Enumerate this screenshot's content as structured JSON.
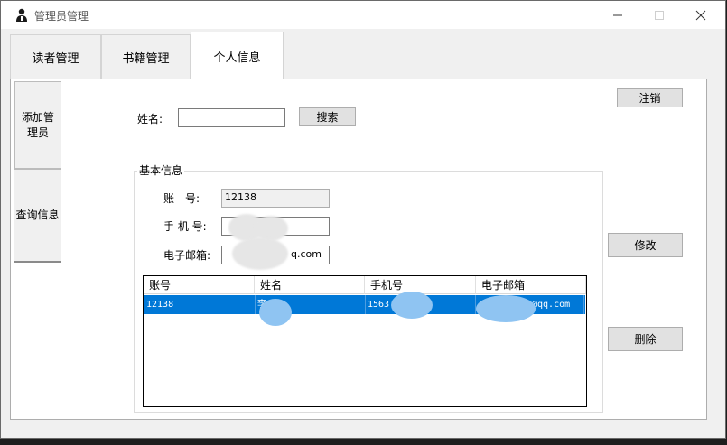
{
  "window": {
    "title": "管理员管理",
    "controls": [
      "minimize",
      "maximize",
      "close"
    ]
  },
  "tabs": [
    {
      "label": "读者管理",
      "active": false
    },
    {
      "label": "书籍管理",
      "active": false
    },
    {
      "label": "个人信息",
      "active": true
    }
  ],
  "side_tabs": [
    {
      "label": "添加管理员"
    },
    {
      "label": "查询信息"
    }
  ],
  "search": {
    "label": "姓名:",
    "value": "",
    "button": "搜索"
  },
  "logout_button": "注销",
  "info_group": {
    "legend": "基本信息",
    "account_label": "账　号:",
    "account_value": "12138",
    "phone_label": "手 机 号:",
    "phone_value": "",
    "email_label": "电子邮箱:",
    "email_value": "q.com"
  },
  "modify_button": "修改",
  "delete_button": "删除",
  "table": {
    "columns": [
      "账号",
      "姓名",
      "手机号",
      "电子邮箱"
    ],
    "rows": [
      {
        "account": "12138",
        "name": "李",
        "phone": "1563",
        "email": "@qq.com"
      }
    ]
  },
  "colors": {
    "selection": "#0078d7",
    "window_bg": "#f0f0f0",
    "panel_bg": "#ffffff"
  }
}
